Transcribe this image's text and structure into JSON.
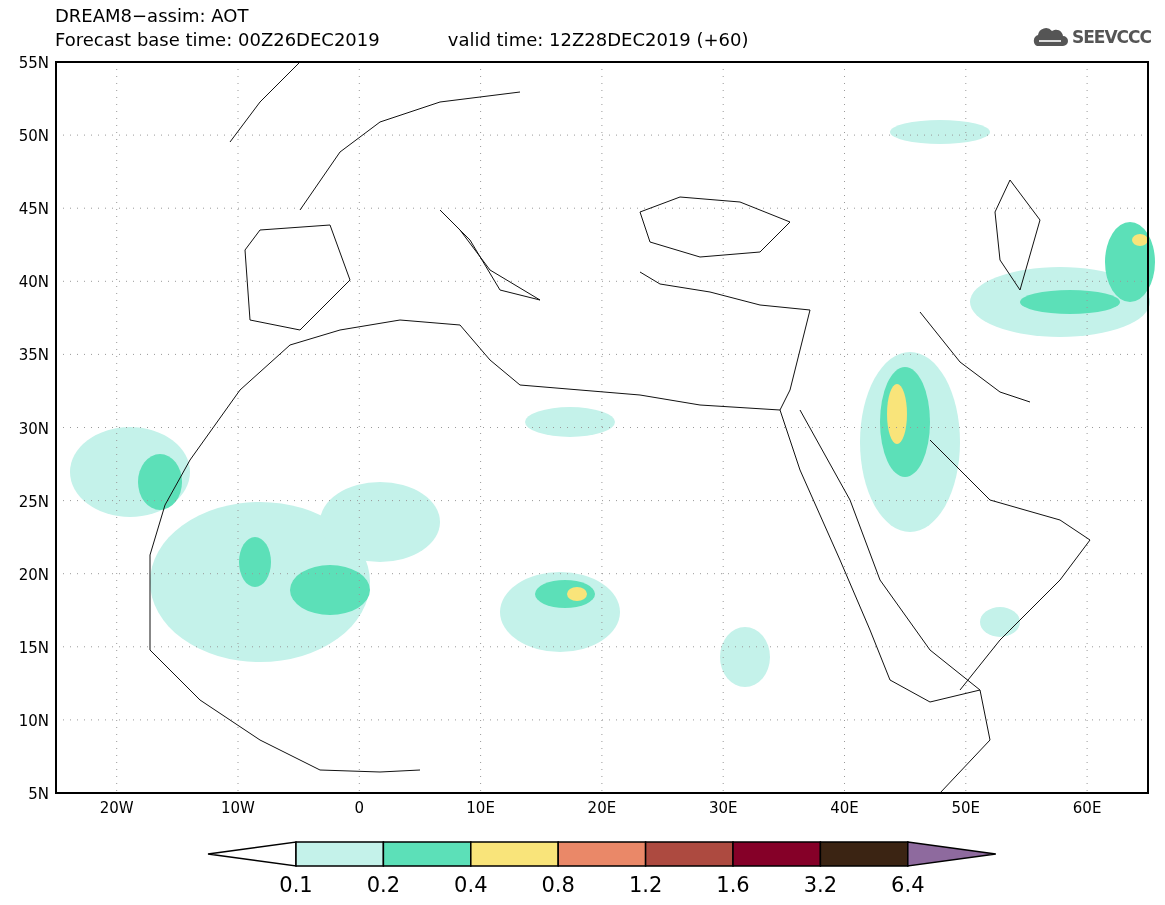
{
  "header": {
    "title": "DREAM8−assim: AOT",
    "base_time": "Forecast base time: 00Z26DEC2019",
    "valid_time": "valid time: 12Z28DEC2019 (+60)",
    "logo_text": "SEEVCCC"
  },
  "map": {
    "lat_ticks": [
      "55N",
      "50N",
      "45N",
      "40N",
      "35N",
      "30N",
      "25N",
      "20N",
      "15N",
      "10N",
      "5N"
    ],
    "lon_ticks": [
      "20W",
      "10W",
      "0",
      "10E",
      "20E",
      "30E",
      "40E",
      "50E",
      "60E"
    ]
  },
  "legend": {
    "swatches": [
      {
        "kind": "below",
        "color": "#ffffff"
      },
      {
        "kind": "box",
        "color": "#c4f2ea"
      },
      {
        "kind": "box",
        "color": "#5ce0b8"
      },
      {
        "kind": "box",
        "color": "#f9e47a"
      },
      {
        "kind": "box",
        "color": "#ea8868"
      },
      {
        "kind": "box",
        "color": "#ad4a40"
      },
      {
        "kind": "box",
        "color": "#850028"
      },
      {
        "kind": "box",
        "color": "#3b2413"
      },
      {
        "kind": "above",
        "color": "#8e6a9e"
      }
    ],
    "labels": [
      "0.1",
      "0.2",
      "0.4",
      "0.8",
      "1.2",
      "1.6",
      "3.2",
      "6.4"
    ]
  }
}
